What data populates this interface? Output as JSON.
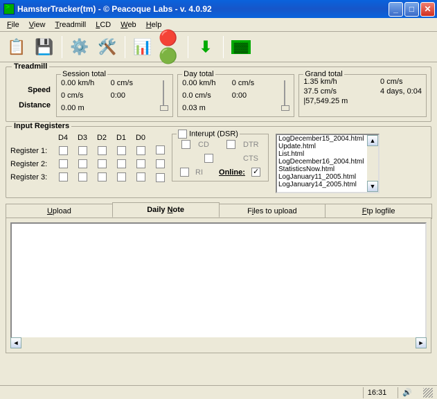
{
  "title": "HamsterTracker(tm) - © Peacoque Labs - v. 4.0.92",
  "menu": [
    "File",
    "View",
    "Treadmill",
    "LCD",
    "Web",
    "Help"
  ],
  "groups": {
    "treadmill": "Treadmill",
    "input": "Input Registers"
  },
  "tm_labels": {
    "speed": "Speed",
    "distance": "Distance"
  },
  "session": {
    "legend": "Session total",
    "speed": "0.00 km/h",
    "cms": "0 cm/s",
    "cms2": "0 cm/s",
    "time": "0:00",
    "dist": "0.00 m"
  },
  "day": {
    "legend": "Day total",
    "speed": "0.00 km/h",
    "cms": "0 cm/s",
    "cms2": "0.0 cm/s",
    "time": "0:00",
    "dist": "0.03 m"
  },
  "grand": {
    "legend": "Grand total",
    "speed": "1.35 km/h",
    "cms": "0 cm/s",
    "cms2": "37.5 cm/s",
    "time": "4 days, 0:04",
    "dist": "|57,549.25 m"
  },
  "reg_headers": [
    "D4",
    "D3",
    "D2",
    "D1",
    "D0"
  ],
  "reg_rows": [
    "Register 1:",
    "Register 2:",
    "Register 3:"
  ],
  "signals": {
    "interrupt": "Interupt (DSR)",
    "cd": "CD",
    "dtr": "DTR",
    "cts": "CTS",
    "ri": "RI",
    "online": "Online:"
  },
  "listbox": [
    "LogDecember15_2004.html",
    "Update.html",
    "List.html",
    "LogDecember16_2004.html",
    "StatisticsNow.html",
    "LogJanuary11_2005.html",
    "LogJanuary14_2005.html"
  ],
  "tabs": {
    "upload": "Upload",
    "daily": "Daily Note",
    "files": "Files to upload",
    "ftp": "Ftp logfile"
  },
  "status": {
    "time": "16:31"
  }
}
